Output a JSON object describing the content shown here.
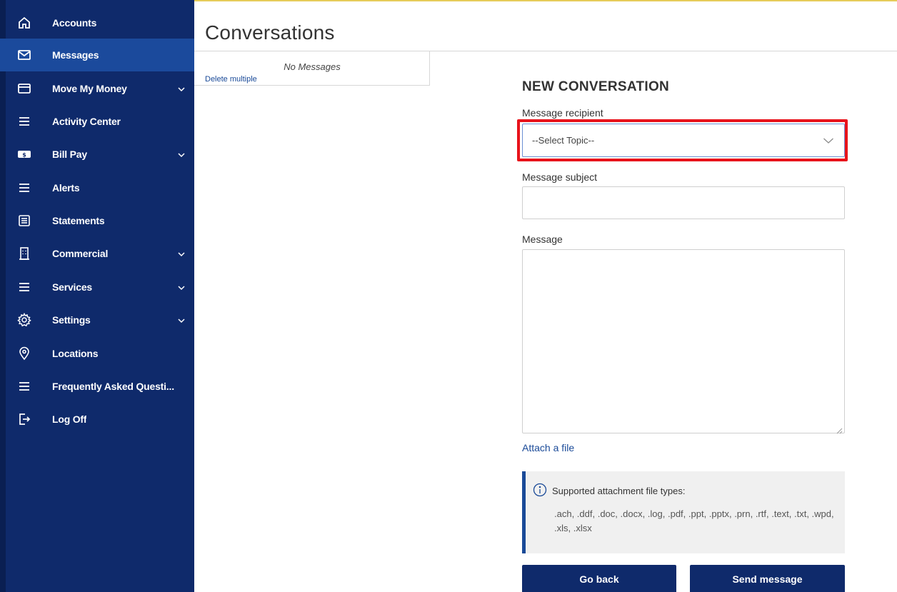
{
  "sidebar": {
    "items": [
      {
        "label": "Accounts",
        "icon": "home-icon",
        "active": false,
        "has_chevron": false
      },
      {
        "label": "Messages",
        "icon": "envelope-icon",
        "active": true,
        "has_chevron": false
      },
      {
        "label": "Move My Money",
        "icon": "card-icon",
        "active": false,
        "has_chevron": true
      },
      {
        "label": "Activity Center",
        "icon": "menu-icon",
        "active": false,
        "has_chevron": false
      },
      {
        "label": "Bill Pay",
        "icon": "dollar-bill-icon",
        "active": false,
        "has_chevron": true
      },
      {
        "label": "Alerts",
        "icon": "menu-icon",
        "active": false,
        "has_chevron": false
      },
      {
        "label": "Statements",
        "icon": "statement-icon",
        "active": false,
        "has_chevron": false
      },
      {
        "label": "Commercial",
        "icon": "building-icon",
        "active": false,
        "has_chevron": true
      },
      {
        "label": "Services",
        "icon": "menu-icon",
        "active": false,
        "has_chevron": true
      },
      {
        "label": "Settings",
        "icon": "gear-icon",
        "active": false,
        "has_chevron": true
      },
      {
        "label": "Locations",
        "icon": "location-pin-icon",
        "active": false,
        "has_chevron": false
      },
      {
        "label": "Frequently Asked Questi...",
        "icon": "menu-icon",
        "active": false,
        "has_chevron": false
      },
      {
        "label": "Log Off",
        "icon": "logout-icon",
        "active": false,
        "has_chevron": false
      }
    ]
  },
  "page": {
    "title": "Conversations"
  },
  "messages_pane": {
    "empty_text": "No Messages",
    "delete_multiple": "Delete multiple"
  },
  "form": {
    "heading": "NEW CONVERSATION",
    "recipient_label": "Message recipient",
    "recipient_value": "--Select Topic--",
    "subject_label": "Message subject",
    "subject_value": "",
    "message_label": "Message",
    "message_value": "",
    "attach_link": "Attach a file",
    "info_title": "Supported attachment file types:",
    "info_types": ".ach,  .ddf,  .doc,  .docx,  .log,  .pdf,  .ppt,  .pptx,  .prn,  .rtf,  .text,  .txt,  .wpd,  .xls,  .xlsx",
    "go_back_label": "Go back",
    "send_label": "Send message"
  },
  "colors": {
    "sidebar_bg": "#0f2a6b",
    "sidebar_active": "#1b4a9c",
    "link": "#1a4a98",
    "highlight": "#e8131b"
  }
}
